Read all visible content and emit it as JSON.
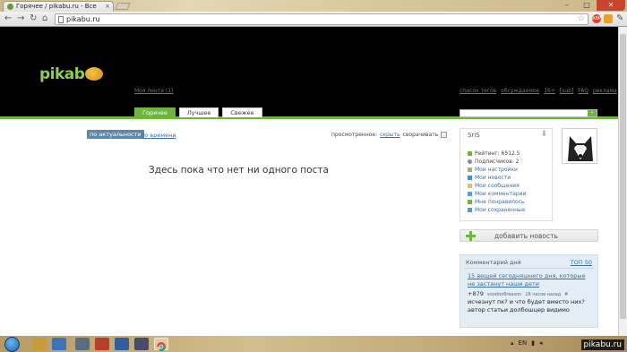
{
  "browser": {
    "tab_title": "Горячее / pikabu.ru - Все",
    "tab_close": "×",
    "url": "pikabu.ru",
    "window_controls": [
      "–",
      "□",
      "✕"
    ],
    "nav_icons": [
      "back-arrow",
      "forward-arrow",
      "reload",
      "home"
    ]
  },
  "site": {
    "logo": "pikabu",
    "my_feed": "Моя лента (1)",
    "top_links": [
      "список тегов",
      "обсуждаемое",
      "16+",
      "[sub]",
      "FAQ",
      "реклама"
    ],
    "sort_tabs": [
      {
        "label": "Горячее",
        "active": true
      },
      {
        "label": "Лучшее",
        "active": false
      },
      {
        "label": "Свежее",
        "active": false
      }
    ],
    "search_button": "»"
  },
  "content": {
    "filter_active": "по актуальности",
    "filter_other": "по времени",
    "viewed_label": "просмотренное:",
    "viewed_hide": "скрыть",
    "viewed_collapse": "сворачивать",
    "empty_message": "Здесь пока что нет ни одного поста"
  },
  "user": {
    "name": "SriS",
    "rating": "Рейтинг: 6512.5",
    "subscribers": "Подписчиков: 2",
    "links": [
      "Мои настройки",
      "Мои новости",
      "Мои сообщения",
      "Мои комментарии",
      "Мне понравилось",
      "Мои сохраненные"
    ]
  },
  "sidebar": {
    "add_news": "добавить новость",
    "comment_of_day_title": "Комментарий дня",
    "top50": "ТОП 50",
    "post_link": "15 вещей сегодняшнего дня, которые не застанут наши дети",
    "score": "+879",
    "author": "voodoo6reason",
    "time": "16 часов назад",
    "hash": "#",
    "comment_text": "исчезнут пк? и что будет вместо них? автор статьи долбошцер видимо"
  },
  "taskbar": {
    "lang": "EN",
    "watermark": "pikabu.ru"
  }
}
